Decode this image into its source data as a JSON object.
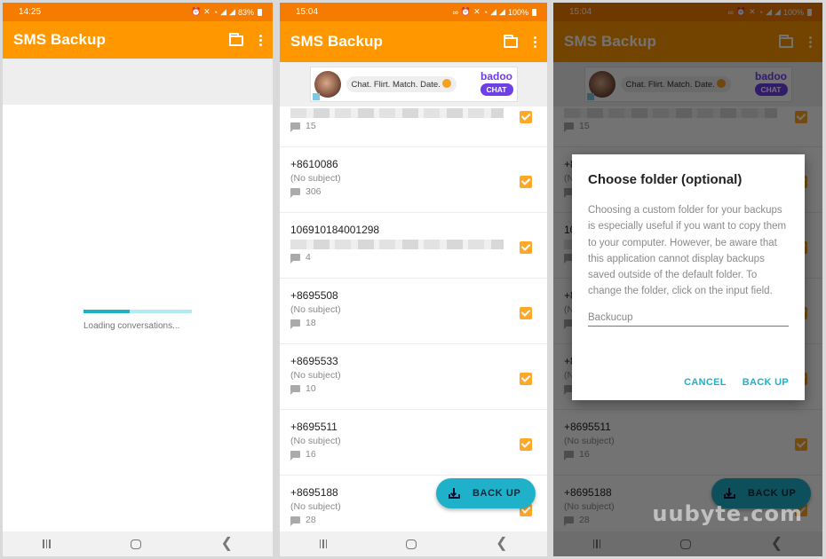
{
  "colors": {
    "status_bar": "#f57c00",
    "app_bar": "#ff9800",
    "accent": "#1eb1c9",
    "checkbox": "#ffa726",
    "ad_brand": "#6e3ee8"
  },
  "screens": [
    {
      "status": {
        "time": "14:25",
        "battery": "83%"
      },
      "appbar": {
        "title": "SMS Backup",
        "folder_icon": "folder-icon",
        "menu_icon": "more-vert-icon"
      },
      "loading": {
        "text": "Loading conversations...",
        "progress": 0.43
      },
      "navbar": {
        "recents": "recents-icon",
        "home": "home-icon",
        "back": "back-icon"
      }
    },
    {
      "status": {
        "time": "15:04",
        "battery": "100%"
      },
      "appbar": {
        "title": "SMS Backup",
        "folder_icon": "folder-icon",
        "menu_icon": "more-vert-icon"
      },
      "ad": {
        "text": "Chat. Flirt. Match. Date.",
        "brand": "badoo",
        "cta": "CHAT"
      },
      "conversations": [
        {
          "number": "",
          "subject": "",
          "count": "15",
          "checked": true,
          "partial": true
        },
        {
          "number": "+8610086",
          "subject": "(No subject)",
          "count": "306",
          "checked": true
        },
        {
          "number": "106910184001298",
          "subject": "",
          "count": "4",
          "checked": true
        },
        {
          "number": "+8695508",
          "subject": "(No subject)",
          "count": "18",
          "checked": true
        },
        {
          "number": "+8695533",
          "subject": "(No subject)",
          "count": "10",
          "checked": true
        },
        {
          "number": "+8695511",
          "subject": "(No subject)",
          "count": "16",
          "checked": true
        },
        {
          "number": "+8695188",
          "subject": "(No subject)",
          "count": "28",
          "checked": true
        }
      ],
      "fab": {
        "label": "BACK UP",
        "icon": "download-icon"
      }
    },
    {
      "status": {
        "time": "15:04",
        "battery": "100%"
      },
      "appbar": {
        "title": "SMS Backup"
      },
      "ad": {
        "text": "Chat. Flirt. Match. Date.",
        "brand": "badoo",
        "cta": "CHAT"
      },
      "conversations": [
        {
          "count": "15"
        },
        {
          "number": "+8695511",
          "subject": "(No subject)",
          "count": "16"
        },
        {
          "number": "+8695188",
          "subject": "(No subject)",
          "count": "28"
        }
      ],
      "dialog": {
        "title": "Choose folder (optional)",
        "body": "Choosing a custom folder for your backups is especially useful if you want to copy them to your computer. However, be aware that this application cannot display backups saved outside of the default folder. To change the folder, click on the input field.",
        "input_value": "Backucup",
        "cancel": "CANCEL",
        "confirm": "BACK UP"
      },
      "fab": {
        "label": "BACK UP"
      },
      "watermark": "uubyte.com"
    }
  ]
}
